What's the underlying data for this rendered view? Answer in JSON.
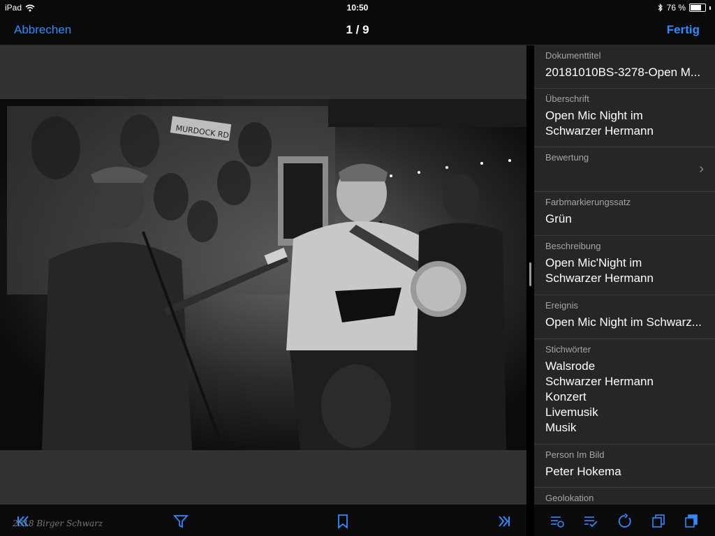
{
  "status": {
    "device": "iPad",
    "time": "10:50",
    "battery_percent": "76 %",
    "battery_level": 0.76
  },
  "nav": {
    "cancel_label": "Abbrechen",
    "counter": "1 / 9",
    "done_label": "Fertig"
  },
  "watermark": "2018 Birger Schwarz",
  "metadata": {
    "title": {
      "label": "Dokumenttitel",
      "value": "20181010BS-3278-Open M..."
    },
    "headline": {
      "label": "Überschrift",
      "lines": [
        "Open Mic Night im",
        "Schwarzer Hermann"
      ]
    },
    "rating": {
      "label": "Bewertung"
    },
    "color_label_set": {
      "label": "Farbmarkierungssatz",
      "value": "Grün"
    },
    "description": {
      "label": "Beschreibung",
      "lines": [
        "Open Mic'Night im",
        "Schwarzer Hermann"
      ]
    },
    "event": {
      "label": "Ereignis",
      "value": "Open Mic Night im Schwarz..."
    },
    "keywords": {
      "label": "Stichwörter",
      "items": [
        "Walsrode",
        "Schwarzer Hermann",
        "Konzert",
        "Livemusik",
        "Musik"
      ]
    },
    "person": {
      "label": "Person Im Bild",
      "value": "Peter Hokema"
    },
    "geolocation": {
      "label": "Geolokation"
    }
  },
  "accent_color": "#2d8cff",
  "icons": {
    "left_toolbar": [
      "first-page-icon",
      "filter-icon",
      "bookmark-icon",
      "last-page-icon"
    ],
    "right_toolbar": [
      "metadata-settings-icon",
      "checklist-icon",
      "rotate-icon",
      "copy-icon",
      "paste-icon"
    ]
  }
}
